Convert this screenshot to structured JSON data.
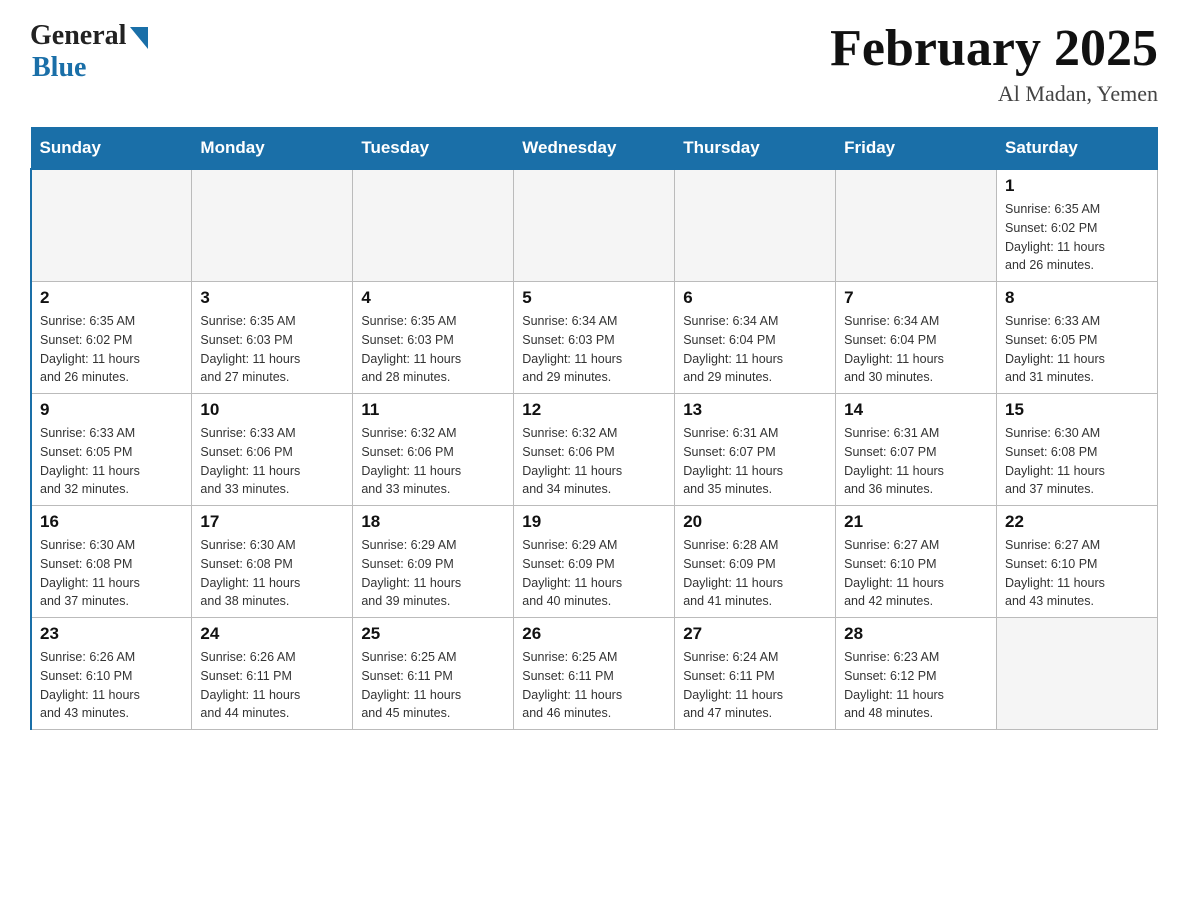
{
  "logo": {
    "general": "General",
    "blue": "Blue"
  },
  "header": {
    "title": "February 2025",
    "subtitle": "Al Madan, Yemen"
  },
  "weekdays": [
    "Sunday",
    "Monday",
    "Tuesday",
    "Wednesday",
    "Thursday",
    "Friday",
    "Saturday"
  ],
  "weeks": [
    [
      {
        "day": "",
        "info": ""
      },
      {
        "day": "",
        "info": ""
      },
      {
        "day": "",
        "info": ""
      },
      {
        "day": "",
        "info": ""
      },
      {
        "day": "",
        "info": ""
      },
      {
        "day": "",
        "info": ""
      },
      {
        "day": "1",
        "info": "Sunrise: 6:35 AM\nSunset: 6:02 PM\nDaylight: 11 hours\nand 26 minutes."
      }
    ],
    [
      {
        "day": "2",
        "info": "Sunrise: 6:35 AM\nSunset: 6:02 PM\nDaylight: 11 hours\nand 26 minutes."
      },
      {
        "day": "3",
        "info": "Sunrise: 6:35 AM\nSunset: 6:03 PM\nDaylight: 11 hours\nand 27 minutes."
      },
      {
        "day": "4",
        "info": "Sunrise: 6:35 AM\nSunset: 6:03 PM\nDaylight: 11 hours\nand 28 minutes."
      },
      {
        "day": "5",
        "info": "Sunrise: 6:34 AM\nSunset: 6:03 PM\nDaylight: 11 hours\nand 29 minutes."
      },
      {
        "day": "6",
        "info": "Sunrise: 6:34 AM\nSunset: 6:04 PM\nDaylight: 11 hours\nand 29 minutes."
      },
      {
        "day": "7",
        "info": "Sunrise: 6:34 AM\nSunset: 6:04 PM\nDaylight: 11 hours\nand 30 minutes."
      },
      {
        "day": "8",
        "info": "Sunrise: 6:33 AM\nSunset: 6:05 PM\nDaylight: 11 hours\nand 31 minutes."
      }
    ],
    [
      {
        "day": "9",
        "info": "Sunrise: 6:33 AM\nSunset: 6:05 PM\nDaylight: 11 hours\nand 32 minutes."
      },
      {
        "day": "10",
        "info": "Sunrise: 6:33 AM\nSunset: 6:06 PM\nDaylight: 11 hours\nand 33 minutes."
      },
      {
        "day": "11",
        "info": "Sunrise: 6:32 AM\nSunset: 6:06 PM\nDaylight: 11 hours\nand 33 minutes."
      },
      {
        "day": "12",
        "info": "Sunrise: 6:32 AM\nSunset: 6:06 PM\nDaylight: 11 hours\nand 34 minutes."
      },
      {
        "day": "13",
        "info": "Sunrise: 6:31 AM\nSunset: 6:07 PM\nDaylight: 11 hours\nand 35 minutes."
      },
      {
        "day": "14",
        "info": "Sunrise: 6:31 AM\nSunset: 6:07 PM\nDaylight: 11 hours\nand 36 minutes."
      },
      {
        "day": "15",
        "info": "Sunrise: 6:30 AM\nSunset: 6:08 PM\nDaylight: 11 hours\nand 37 minutes."
      }
    ],
    [
      {
        "day": "16",
        "info": "Sunrise: 6:30 AM\nSunset: 6:08 PM\nDaylight: 11 hours\nand 37 minutes."
      },
      {
        "day": "17",
        "info": "Sunrise: 6:30 AM\nSunset: 6:08 PM\nDaylight: 11 hours\nand 38 minutes."
      },
      {
        "day": "18",
        "info": "Sunrise: 6:29 AM\nSunset: 6:09 PM\nDaylight: 11 hours\nand 39 minutes."
      },
      {
        "day": "19",
        "info": "Sunrise: 6:29 AM\nSunset: 6:09 PM\nDaylight: 11 hours\nand 40 minutes."
      },
      {
        "day": "20",
        "info": "Sunrise: 6:28 AM\nSunset: 6:09 PM\nDaylight: 11 hours\nand 41 minutes."
      },
      {
        "day": "21",
        "info": "Sunrise: 6:27 AM\nSunset: 6:10 PM\nDaylight: 11 hours\nand 42 minutes."
      },
      {
        "day": "22",
        "info": "Sunrise: 6:27 AM\nSunset: 6:10 PM\nDaylight: 11 hours\nand 43 minutes."
      }
    ],
    [
      {
        "day": "23",
        "info": "Sunrise: 6:26 AM\nSunset: 6:10 PM\nDaylight: 11 hours\nand 43 minutes."
      },
      {
        "day": "24",
        "info": "Sunrise: 6:26 AM\nSunset: 6:11 PM\nDaylight: 11 hours\nand 44 minutes."
      },
      {
        "day": "25",
        "info": "Sunrise: 6:25 AM\nSunset: 6:11 PM\nDaylight: 11 hours\nand 45 minutes."
      },
      {
        "day": "26",
        "info": "Sunrise: 6:25 AM\nSunset: 6:11 PM\nDaylight: 11 hours\nand 46 minutes."
      },
      {
        "day": "27",
        "info": "Sunrise: 6:24 AM\nSunset: 6:11 PM\nDaylight: 11 hours\nand 47 minutes."
      },
      {
        "day": "28",
        "info": "Sunrise: 6:23 AM\nSunset: 6:12 PM\nDaylight: 11 hours\nand 48 minutes."
      },
      {
        "day": "",
        "info": ""
      }
    ]
  ],
  "colors": {
    "header_bg": "#1a6fa8",
    "header_text": "#ffffff",
    "border": "#bbbbbb",
    "empty_bg": "#f5f5f5"
  }
}
